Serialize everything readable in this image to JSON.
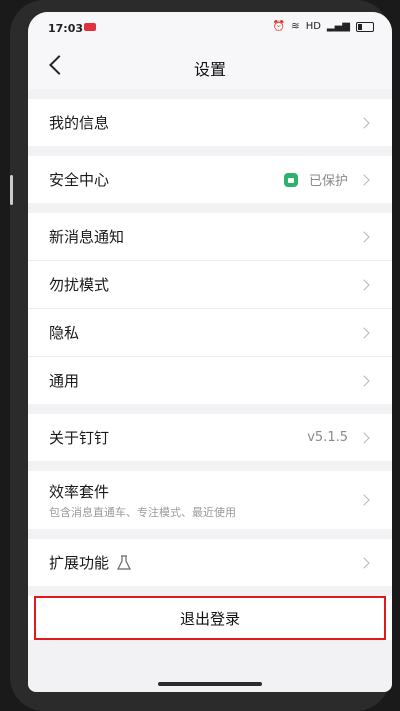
{
  "status": {
    "time": "17:03",
    "network": "HD"
  },
  "header": {
    "title": "设置"
  },
  "groups": [
    {
      "items": [
        {
          "label": "我的信息"
        }
      ]
    },
    {
      "items": [
        {
          "label": "安全中心",
          "value": "已保护"
        }
      ]
    },
    {
      "items": [
        {
          "label": "新消息通知"
        },
        {
          "label": "勿扰模式"
        },
        {
          "label": "隐私"
        },
        {
          "label": "通用"
        }
      ]
    },
    {
      "items": [
        {
          "label": "关于钉钉",
          "value": "v5.1.5"
        }
      ]
    },
    {
      "items": [
        {
          "label": "效率套件",
          "sublabel": "包含消息直通车、专注模式、最近使用"
        }
      ]
    },
    {
      "items": [
        {
          "label": "扩展功能"
        }
      ]
    }
  ],
  "logout": {
    "label": "退出登录"
  },
  "colors": {
    "accent": "#2cb26b",
    "highlight": "#e0191f"
  }
}
